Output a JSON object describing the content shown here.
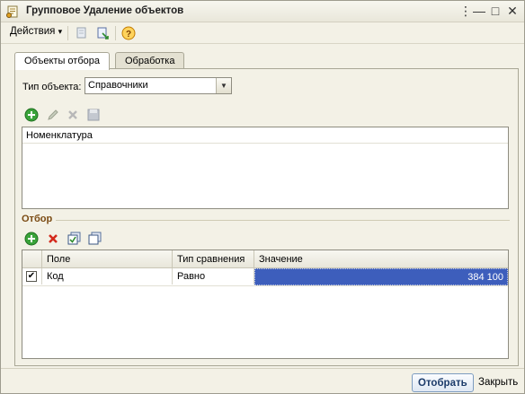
{
  "window": {
    "title": "Групповое Удаление объектов",
    "controls": {
      "more": "⋮",
      "minimize": "—",
      "maximize": "□",
      "close": "✕"
    }
  },
  "toolbar": {
    "actions_label": "Действия",
    "actions_arrow": "▾",
    "icons": [
      "delete-mark-icon",
      "export-icon",
      "help-icon"
    ]
  },
  "tabs": [
    {
      "label": "Объекты отбора",
      "active": true
    },
    {
      "label": "Обработка",
      "active": false
    }
  ],
  "object_type": {
    "label": "Тип объекта:",
    "value": "Справочники"
  },
  "objects_list": {
    "toolbar_icons": [
      "add-icon",
      "edit-icon",
      "delete-icon",
      "save-icon"
    ],
    "items": [
      "Номенклатура"
    ]
  },
  "filter": {
    "section_title": "Отбор",
    "toolbar_icons": [
      "add-icon",
      "delete-icon",
      "check-all-icon",
      "uncheck-all-icon"
    ],
    "columns": [
      "Поле",
      "Тип сравнения",
      "Значение"
    ],
    "rows": [
      {
        "checked": true,
        "field": "Код",
        "comparison": "Равно",
        "value": "384 100"
      }
    ]
  },
  "buttons": {
    "select": "Отобрать",
    "close": "Закрыть"
  },
  "colors": {
    "selected_cell": "#3d5ebc",
    "window_bg": "#f3f1e6",
    "section_title": "#7a4a12"
  }
}
